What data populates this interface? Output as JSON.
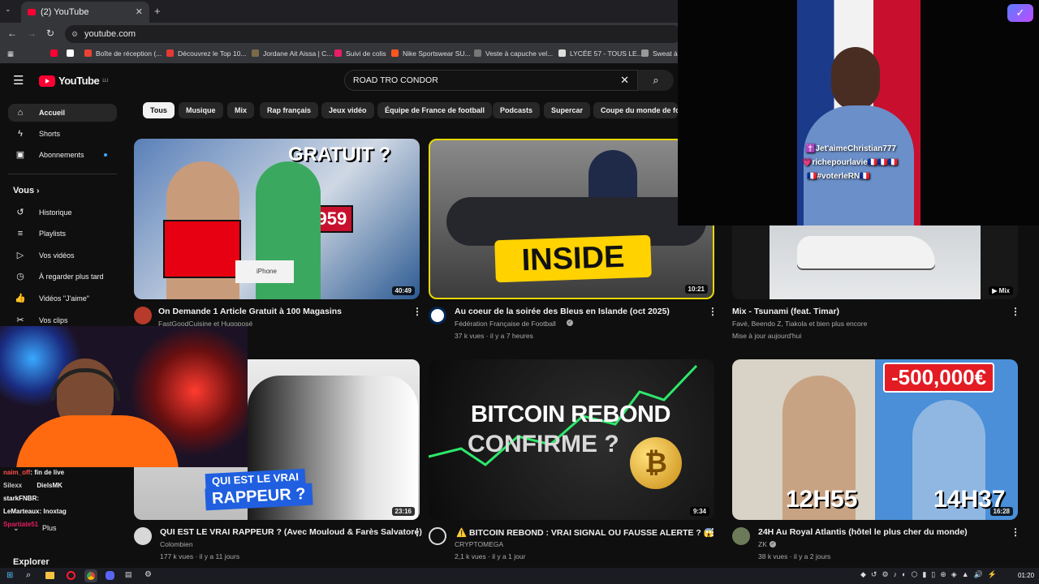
{
  "browser": {
    "tab_title": "(2) YouTube",
    "url": "youtube.com",
    "bookmarks": [
      "Boîte de réception (...",
      "Découvrez le Top 10...",
      "Jordane Ait Aissa | C...",
      "Suivi de colis",
      "Nike Sportswear SU...",
      "Veste à capuche vel...",
      "LYCÉE 57 - TOUS LE...",
      "Sweat à"
    ]
  },
  "header": {
    "logo_text": "YouTube",
    "logo_country": "LU",
    "search_value": "ROAD TRO CONDOR"
  },
  "chips": [
    "Tous",
    "Musique",
    "Mix",
    "Rap français",
    "Jeux vidéo",
    "Équipe de France de football",
    "Podcasts",
    "Supercar",
    "Coupe du monde de fo"
  ],
  "sidebar": {
    "main": [
      {
        "label": "Accueil",
        "icon": "home-icon"
      },
      {
        "label": "Shorts",
        "icon": "shorts-icon"
      },
      {
        "label": "Abonnements",
        "icon": "subscriptions-icon"
      }
    ],
    "you_title": "Vous",
    "you": [
      {
        "label": "Historique",
        "icon": "history-icon"
      },
      {
        "label": "Playlists",
        "icon": "playlists-icon"
      },
      {
        "label": "Vos vidéos",
        "icon": "your-videos-icon"
      },
      {
        "label": "À regarder plus tard",
        "icon": "watch-later-icon"
      },
      {
        "label": "Vidéos \"J'aime\"",
        "icon": "liked-icon"
      },
      {
        "label": "Vos clips",
        "icon": "clips-icon"
      }
    ],
    "more": "Plus",
    "explore": "Explorer"
  },
  "videos": [
    {
      "title": "On Demande 1 Article Gratuit à 100 Magasins",
      "channel": "FastGoodCuisine et Hugoposé",
      "meta": "",
      "duration": "40:49",
      "thumb_text": "GRATUIT ?",
      "thumb_price": "$4959",
      "thumb_device": "iPhone",
      "color": "#4a6fa8"
    },
    {
      "title": "Au coeur de la soirée des Bleus en Islande (oct 2025)",
      "channel": "Fédération Française de Football",
      "meta": "37 k vues · il y a 7 heures",
      "duration": "10:21",
      "thumb_text": "INSIDE",
      "color": "#6e6e6e"
    },
    {
      "title": "Mix - Tsunami (feat. Timar)",
      "channel": "Favé, Beendo Z, Tiakola et bien plus encore",
      "meta": "Mise à jour aujourd'hui",
      "duration": "Mix",
      "color": "#9aa0a8"
    },
    {
      "title": "QUI EST LE VRAI RAPPEUR ? (Avec Mouloud & Farès Salvatore)",
      "channel": "Colombien",
      "meta": "177 k vues · il y a 11 jours",
      "duration": "23:16",
      "thumb_text_1": "QUI EST LE VRAI",
      "thumb_text_2": "RAPPEUR ?",
      "color": "#2a2a2a"
    },
    {
      "title": "⚠️ BITCOIN REBOND : VRAI SIGNAL OU FAUSSE ALERTE ? 😱",
      "channel": "CRYPTOMEGA",
      "meta": "2,1 k vues · il y a 1 jour",
      "duration": "9:34",
      "thumb_text_1": "BITCOIN REBOND",
      "thumb_text_2": "CONFIRME ?",
      "color": "#141414"
    },
    {
      "title": "24H Au Royal Atlantis (hôtel le plus cher du monde)",
      "channel": "ZK",
      "meta": "38 k vues · il y a 2 jours",
      "duration": "16:28",
      "thumb_text_1": "-500,000€",
      "thumb_time_1": "12H55",
      "thumb_time_2": "14H37",
      "color": "#3a7fc8"
    }
  ],
  "tiktok_overlay": {
    "captions": [
      "✝️Jet'aimeChristian777",
      "💗richepourlavie🇫🇷🇫🇷🇫🇷",
      "🇫🇷#voterleRN🇫🇷"
    ]
  },
  "chat": [
    {
      "user": "naim_off",
      "text": ": fin de live"
    },
    {
      "user": "Silexx",
      "text": "DielsMK"
    },
    {
      "user": "starkFNBR",
      "text": ":"
    },
    {
      "user": "LeMarteaux",
      "text": ": Inoxtag"
    },
    {
      "user": "Spartiate51",
      "text": ""
    }
  ],
  "taskbar": {
    "time": "01:20"
  },
  "colors": {
    "accent_red": "#ff0033",
    "background": "#0f0f0f",
    "chip_bg": "#272727"
  }
}
